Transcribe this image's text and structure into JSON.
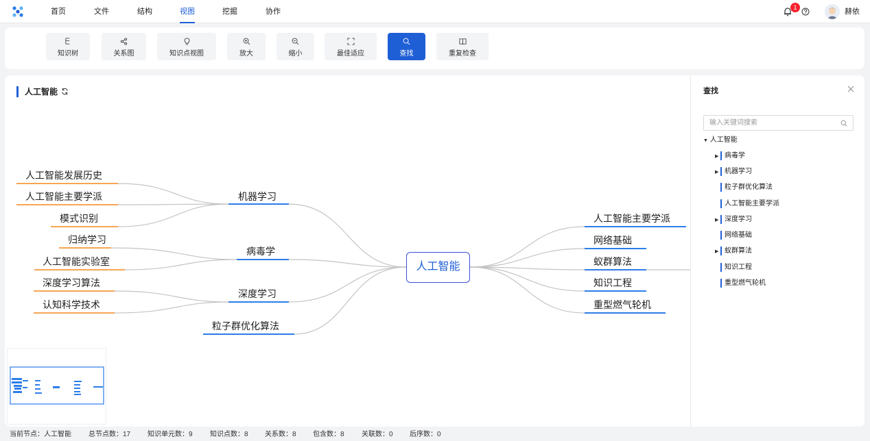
{
  "nav": {
    "items": [
      {
        "label": "首页",
        "active": false
      },
      {
        "label": "文件",
        "active": false
      },
      {
        "label": "结构",
        "active": false
      },
      {
        "label": "视图",
        "active": true
      },
      {
        "label": "挖掘",
        "active": false
      },
      {
        "label": "协作",
        "active": false
      }
    ],
    "notification_count": "1",
    "username": "赫依",
    "accent": "#1f5fd6"
  },
  "toolbar": {
    "buttons": [
      {
        "label": "知识树",
        "icon": "tree-icon"
      },
      {
        "label": "关系图",
        "icon": "share-graph-icon"
      },
      {
        "label": "知识点视图",
        "icon": "bulb-icon"
      },
      {
        "label": "放大",
        "icon": "zoom-in-icon"
      },
      {
        "label": "缩小",
        "icon": "zoom-out-icon"
      },
      {
        "label": "最佳适应",
        "icon": "fit-screen-icon"
      },
      {
        "label": "查找",
        "icon": "search-icon",
        "active": true
      },
      {
        "label": "重复检查",
        "icon": "book-check-icon"
      }
    ]
  },
  "canvas": {
    "title": "人工智能",
    "root": "人工智能",
    "left_branches": [
      {
        "label": "机器学习",
        "children": [
          "人工智能发展历史",
          "人工智能主要学派",
          "模式识别"
        ]
      },
      {
        "label": "病毒学",
        "children": [
          "归纳学习",
          "人工智能实验室"
        ]
      },
      {
        "label": "深度学习",
        "children": [
          "深度学习算法",
          "认知科学技术"
        ]
      },
      {
        "label": "粒子群优化算法",
        "children": []
      }
    ],
    "right_branches": [
      "人工智能主要学派",
      "网络基础",
      "蚁群算法",
      "知识工程",
      "重型燃气轮机"
    ]
  },
  "search_panel": {
    "title": "查找",
    "placeholder": "输入关键词搜索",
    "tree_root": "人工智能",
    "items": [
      {
        "label": "病毒学",
        "expandable": true
      },
      {
        "label": "机器学习",
        "expandable": true
      },
      {
        "label": "粒子群优化算法",
        "expandable": false
      },
      {
        "label": "人工智能主要学派",
        "expandable": false
      },
      {
        "label": "深度学习",
        "expandable": true
      },
      {
        "label": "网络基础",
        "expandable": false
      },
      {
        "label": "蚁群算法",
        "expandable": true
      },
      {
        "label": "知识工程",
        "expandable": false
      },
      {
        "label": "重型燃气轮机",
        "expandable": false
      }
    ]
  },
  "status": {
    "current_node": "当前节点：人工智能",
    "total_nodes": "总节点数：17",
    "knowledge_units": "知识单元数：9",
    "knowledge_points": "知识点数：8",
    "relations": "关系数：8",
    "contains": "包含数：8",
    "associations": "关联数：0",
    "sequences": "后序数：0"
  }
}
